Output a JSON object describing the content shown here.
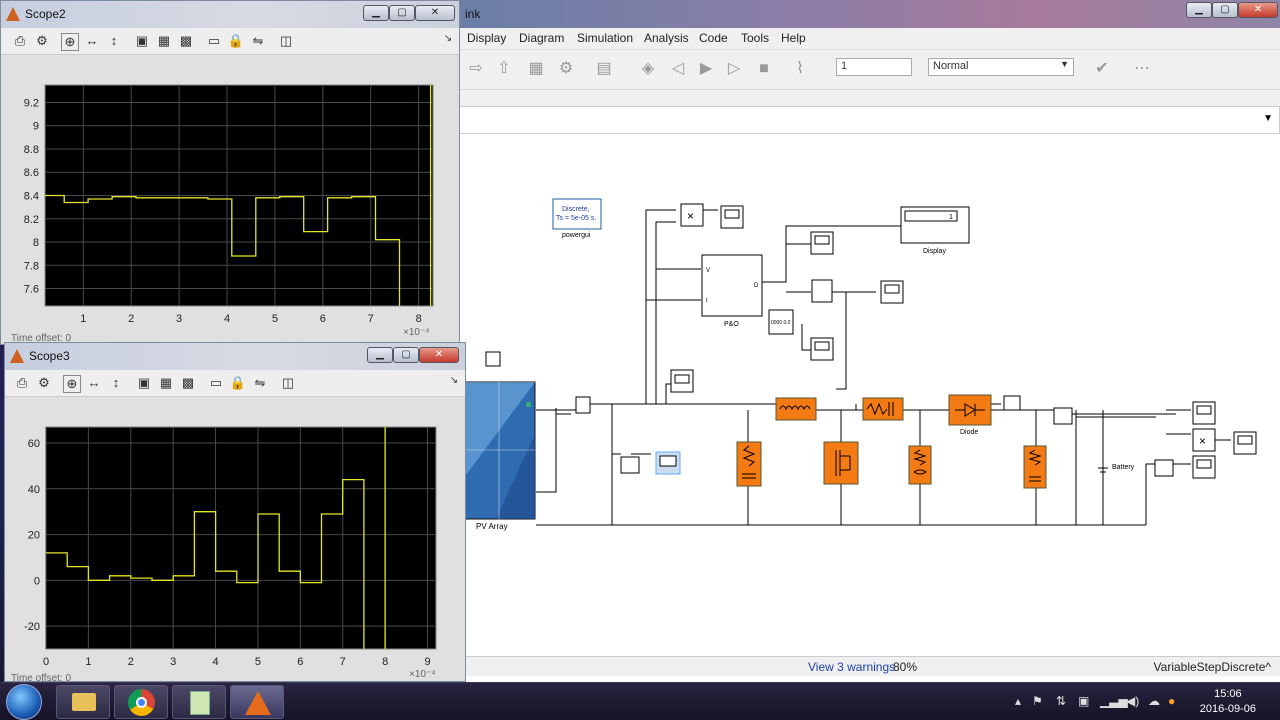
{
  "main_window": {
    "title": "ink",
    "menu": [
      "Display",
      "Diagram",
      "Simulation",
      "Analysis",
      "Code",
      "Tools",
      "Help"
    ],
    "stop_time": "1",
    "sim_mode": "Normal",
    "status_warnings": "View 3 warnings",
    "status_zoom": "80%",
    "status_solver": "VariableStepDiscrete^"
  },
  "diagram": {
    "powergui_line1": "Discrete,",
    "powergui_line2": "Ts = 5e-05 s.",
    "powergui_label": "powergui",
    "display_label": "Display",
    "display_value": "1",
    "mppt_label": "P&O",
    "mppt_in_v": "V",
    "mppt_in_i": "I",
    "mppt_out": "D",
    "pv_label": "PV Array",
    "diode_label": "Diode",
    "battery_label": "Battery",
    "mult_symbol": "×",
    "const_value": "0000 0.0"
  },
  "scope2": {
    "title": "Scope2",
    "time_offset": "Time offset:  0",
    "exponent": "×10⁻⁴",
    "yticks": [
      "9.2",
      "9",
      "8.8",
      "8.6",
      "8.4",
      "8.2",
      "8",
      "7.8",
      "7.6"
    ],
    "xticks": [
      "1",
      "2",
      "3",
      "4",
      "5",
      "6",
      "7",
      "8"
    ]
  },
  "scope3": {
    "title": "Scope3",
    "time_offset": "Time offset:  0",
    "exponent": "×10⁻⁴",
    "yticks": [
      "60",
      "40",
      "20",
      "0",
      "-20"
    ],
    "xticks": [
      "0",
      "1",
      "2",
      "3",
      "4",
      "5",
      "6",
      "7",
      "8",
      "9"
    ]
  },
  "chart_data": [
    {
      "type": "line",
      "title": "Scope2",
      "xlim": [
        0.2,
        8.3
      ],
      "ylim": [
        7.45,
        9.35
      ],
      "x_scale": "×10^-4",
      "grid": true,
      "series": [
        {
          "color": "#e5e52a",
          "x": [
            0.2,
            0.6,
            0.6,
            1.1,
            1.1,
            1.6,
            1.6,
            2.1,
            2.1,
            2.6,
            2.6,
            3.1,
            3.1,
            3.6,
            3.6,
            4.1,
            4.1,
            4.6,
            4.6,
            5.1,
            5.1,
            5.6,
            5.6,
            6.1,
            6.1,
            6.6,
            6.6,
            7.1,
            7.1,
            7.6,
            7.6
          ],
          "y": [
            8.4,
            8.4,
            8.34,
            8.34,
            8.37,
            8.37,
            8.39,
            8.39,
            8.38,
            8.38,
            8.38,
            8.38,
            8.38,
            8.38,
            8.37,
            8.37,
            7.88,
            7.88,
            8.38,
            8.38,
            8.39,
            8.39,
            8.09,
            8.09,
            8.38,
            8.38,
            8.39,
            8.39,
            8.02,
            8.02,
            7.45
          ]
        }
      ]
    },
    {
      "type": "line",
      "title": "Scope3",
      "xlim": [
        0,
        9.2
      ],
      "ylim": [
        -30,
        67
      ],
      "x_scale": "×10^-4",
      "grid": true,
      "series": [
        {
          "color": "#e5e52a",
          "x": [
            0,
            0.5,
            0.5,
            1,
            1,
            1.5,
            1.5,
            2,
            2,
            2.5,
            2.5,
            3,
            3,
            3.5,
            3.5,
            4,
            4,
            4.5,
            4.5,
            5,
            5,
            5.5,
            5.5,
            6,
            6,
            6.5,
            6.5,
            7,
            7,
            7.5,
            7.5
          ],
          "y": [
            12,
            12,
            6,
            6,
            0,
            0,
            2,
            2,
            1,
            1,
            0,
            0,
            2,
            2,
            30,
            30,
            4,
            4,
            -1,
            -1,
            29,
            29,
            4,
            4,
            -1,
            -1,
            29,
            29,
            44,
            44,
            -30
          ]
        }
      ]
    }
  ],
  "taskbar": {
    "time": "15:06",
    "date": "2016-09-06"
  }
}
